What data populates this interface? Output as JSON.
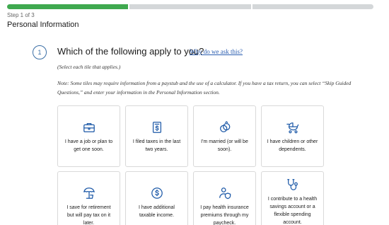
{
  "progress": {
    "filled_segments": 1,
    "total_segments": 3
  },
  "header": {
    "step": "Step 1 of 3",
    "title": "Personal Information"
  },
  "question": {
    "number": "1",
    "text": "Which of the following apply to you?",
    "why_link": "Why do we ask this?",
    "instruction": "(Select each tile that applies.)",
    "note": "Note: Some tiles may require information from a paystub and the use of a calculator. If you have a tax return, you can select “Skip Guided Questions,” and enter your information in the Personal Information section."
  },
  "tiles": [
    {
      "icon": "briefcase-icon",
      "label": "I have a job or plan to get one soon."
    },
    {
      "icon": "tax-document-icon",
      "label": "I filed taxes in the last two years."
    },
    {
      "icon": "rings-icon",
      "label": "I'm married (or will be soon)."
    },
    {
      "icon": "stroller-icon",
      "label": "I have children or other dependents."
    },
    {
      "icon": "umbrella-chair-icon",
      "label": "I save for retirement but will pay tax on it later."
    },
    {
      "icon": "dollar-coin-icon",
      "label": "I have additional taxable income."
    },
    {
      "icon": "health-shield-icon",
      "label": "I pay health insurance premiums through my paycheck."
    },
    {
      "icon": "stethoscope-icon",
      "label": "I contribute to a health savings account or a flexible spending account."
    }
  ],
  "colors": {
    "progress_filled": "#3fa94f",
    "progress_empty": "#d4d7d9",
    "accent": "#1e5aa8",
    "link": "#2a5db0"
  }
}
